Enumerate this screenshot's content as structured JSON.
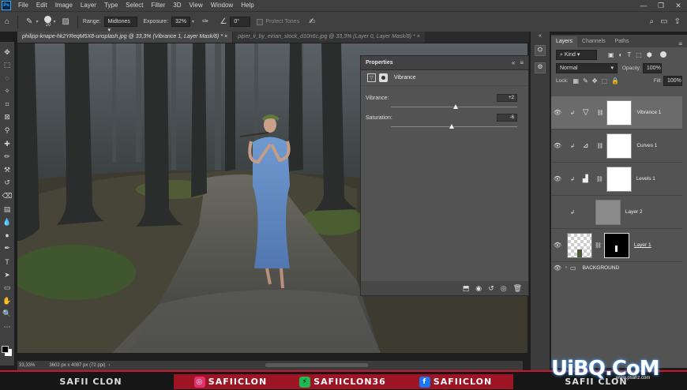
{
  "menu": [
    "File",
    "Edit",
    "Image",
    "Layer",
    "Type",
    "Select",
    "Filter",
    "3D",
    "View",
    "Window",
    "Help"
  ],
  "window_controls": [
    "—",
    "❐",
    "✕"
  ],
  "options": {
    "brush_size": "20",
    "range_label": "Range:",
    "range_value": "Midtones",
    "exposure_label": "Exposure:",
    "exposure_value": "32%",
    "angle_value": "0°",
    "protect_tones": "Protect Tones"
  },
  "tabs": [
    {
      "label": "philipp-knape-hk2YReqM5X8-unsplash.jpg @ 33,3% (Vibrance 1, Layer Mask/8) *",
      "close": "×",
      "active": true
    },
    {
      "label": "piper_ii_by_eirian_stock_d10n6c.jpg @ 33,3% (Layer 0, Layer Mask/8) *",
      "close": "×",
      "active": false
    }
  ],
  "status": {
    "zoom": "33,33%",
    "size": "3602 px x 4087 px (72 ppi)"
  },
  "properties": {
    "title": "Properties",
    "panel_name": "Vibrance",
    "vibrance_label": "Vibrance:",
    "vibrance_value": "+2",
    "vibrance_fraction": 0.51,
    "saturation_label": "Saturation:",
    "saturation_value": "-6",
    "saturation_fraction": 0.48
  },
  "layers_panel": {
    "tabs": [
      "Layers",
      "Channels",
      "Paths"
    ],
    "filter_kind": "Kind",
    "blend_mode": "Normal",
    "opacity_label": "Opacity:",
    "opacity_value": "100%",
    "lock_label": "Lock:",
    "fill_label": "Fill:",
    "fill_value": "100%",
    "layers": [
      {
        "name": "Vibrance 1",
        "selected": true
      },
      {
        "name": "Curves 1",
        "selected": false
      },
      {
        "name": "Levels 1",
        "selected": false
      },
      {
        "name": "Layer 2",
        "selected": false
      },
      {
        "name": "Layer 1",
        "selected": false
      },
      {
        "name": "BACKGROUND",
        "selected": false
      }
    ]
  },
  "banner": {
    "left": "SAFII CLON",
    "instagram": "SAFIICLON",
    "stream": "SAFIICLON36",
    "facebook": "SAFIICLON",
    "right": "SAFII CLON"
  },
  "watermark": {
    "main": "UiBQ.CoM",
    "sub": "www.psahz.com"
  },
  "colors": {
    "accent": "#31a8ff",
    "banner_red": "#cc1530"
  }
}
